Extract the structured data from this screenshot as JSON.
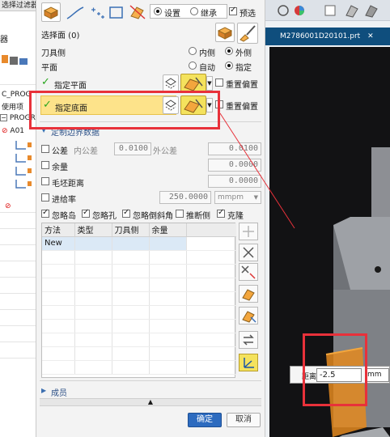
{
  "background_left": {
    "filter_text": "选择过滤器",
    "label_a": "器",
    "label_prog": "C_PROG",
    "label_unused": "使用项",
    "label_prog2": "PROGR",
    "label_a01": "A01"
  },
  "background_right": {
    "tab_title": "M2786001D20101.prt",
    "distance_label": "距离",
    "distance_value": "-2.5",
    "distance_unit": "mm"
  },
  "dialog": {
    "mode_setting": "设置",
    "mode_inherit": "继承",
    "preview": "预选",
    "select_face": "选择面 (0)",
    "tool_side": "刀具侧",
    "tool_inside": "内侧",
    "tool_outside": "外侧",
    "plane": "平面",
    "plane_auto": "自动",
    "plane_specify": "指定",
    "specify_plane": "指定平面",
    "reset_offset_1": "重置偏置",
    "specify_bottom": "指定底面",
    "reset_offset_2": "重置偏置",
    "section_title": "定制边界数据",
    "tolerance": "公差",
    "inner_tol_label": "内公差",
    "inner_tol_value": "0.0100",
    "outer_tol_label": "外公差",
    "outer_tol_value": "0.0100",
    "stock": "余量",
    "stock_value": "0.0000",
    "blank_dist": "毛坯距离",
    "blank_value": "0.0000",
    "feed_rate": "进给率",
    "feed_value": "250.0000",
    "feed_unit": "mmpm",
    "ignore_island": "忽略岛",
    "ignore_hole": "忽略孔",
    "ignore_chamfer": "忽略倒斜角",
    "infer_side": "推断侧",
    "fill_gap": "克隆",
    "table_headers": [
      "方法",
      "类型",
      "刀具侧",
      "余量"
    ],
    "table_rows": [
      [
        "New",
        "",
        "",
        ""
      ]
    ],
    "members_section": "成员",
    "ok_button": "确定",
    "cancel_button": "取消"
  }
}
